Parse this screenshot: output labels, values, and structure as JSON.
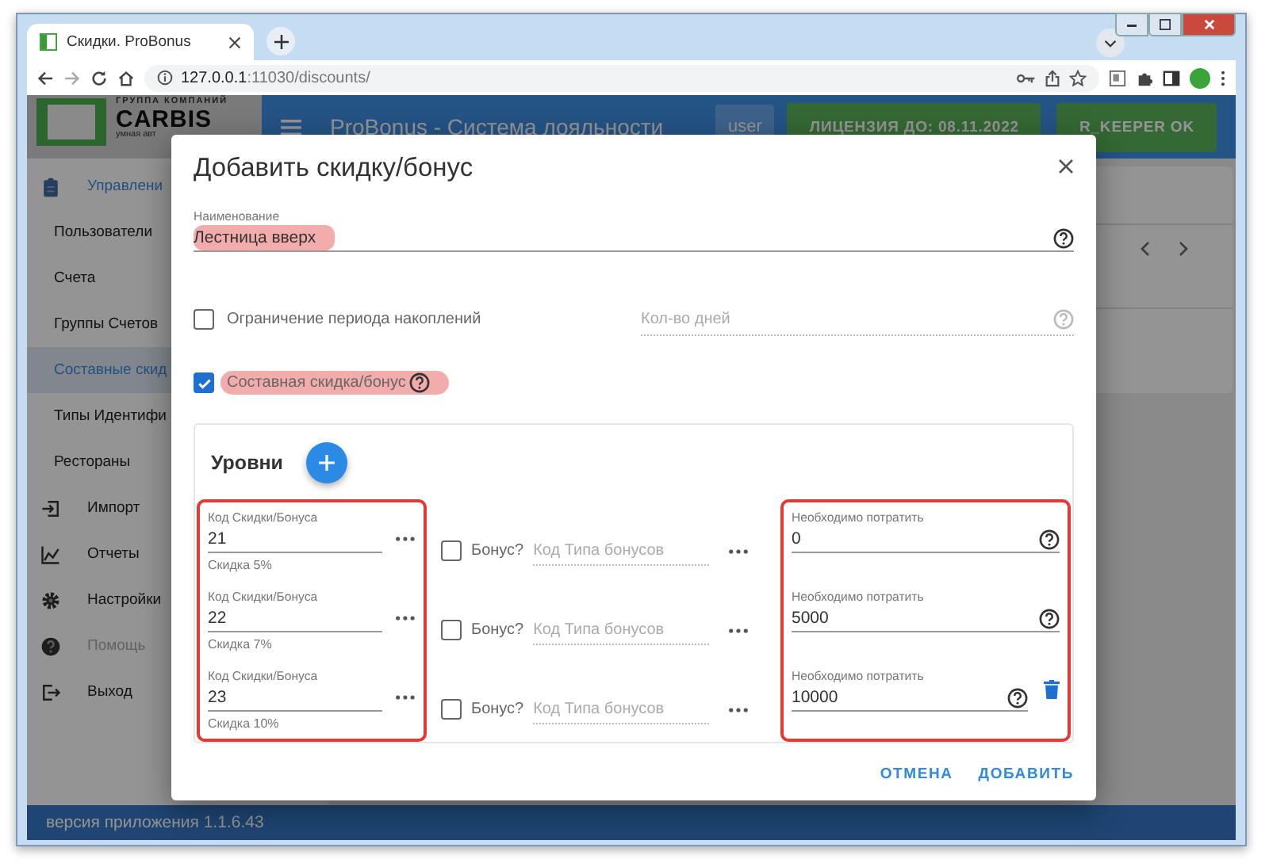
{
  "browser": {
    "tab_title": "Скидки. ProBonus",
    "url_host": "127.0.0.1",
    "url_path": ":11030/discounts/"
  },
  "app": {
    "logo": {
      "tagline": "ГРУППА КОМПАНИЙ",
      "name": "CARBIS",
      "slogan": "умная авт"
    },
    "title": "ProBonus - Система лояльности",
    "user": "user",
    "license": "ЛИЦЕНЗИЯ ДО: 08.11.2022",
    "status": "R_KEEPER OK"
  },
  "sidebar": {
    "items": [
      {
        "label": "Управлени",
        "kind": "section",
        "selected": false,
        "disabled": false
      },
      {
        "label": "Пользователи",
        "kind": "sub",
        "selected": false,
        "disabled": false
      },
      {
        "label": "Счета",
        "kind": "sub",
        "selected": false,
        "disabled": false
      },
      {
        "label": "Группы Счетов",
        "kind": "sub",
        "selected": false,
        "disabled": false
      },
      {
        "label": "Составные скид",
        "kind": "sub",
        "selected": true,
        "disabled": false
      },
      {
        "label": "Типы Идентифи",
        "kind": "sub",
        "selected": false,
        "disabled": false
      },
      {
        "label": "Рестораны",
        "kind": "sub",
        "selected": false,
        "disabled": false
      },
      {
        "label": "Импорт",
        "kind": "menu",
        "selected": false,
        "disabled": false
      },
      {
        "label": "Отчеты",
        "kind": "menu",
        "selected": false,
        "disabled": false
      },
      {
        "label": "Настройки",
        "kind": "menu",
        "selected": false,
        "disabled": false
      },
      {
        "label": "Помощь",
        "kind": "menu",
        "selected": false,
        "disabled": true
      },
      {
        "label": "Выход",
        "kind": "menu",
        "selected": false,
        "disabled": false
      }
    ]
  },
  "dialog": {
    "title": "Добавить скидку/бонус",
    "name": {
      "label": "Наименование",
      "value": "Лестница вверх",
      "highlighted": true
    },
    "period": {
      "label": "Ограничение периода накоплений",
      "checked": false
    },
    "days": {
      "placeholder": "Кол-во дней",
      "disabled": true
    },
    "composite": {
      "label": "Составная скидка/бонус",
      "checked": true,
      "highlighted": true
    },
    "levels": {
      "title": "Уровни",
      "code_framed": true,
      "spend_framed": true,
      "rows": [
        {
          "code_label": "Код Скидки/Бонуса",
          "code": "21",
          "code_hint": "Скидка 5%",
          "bonus_label": "Бонус?",
          "bonus_checked": false,
          "bonus_type_placeholder": "Код Типа бонусов",
          "spend_label": "Необходимо потратить",
          "spend": "0",
          "deletable": false
        },
        {
          "code_label": "Код Скидки/Бонуса",
          "code": "22",
          "code_hint": "Скидка 7%",
          "bonus_label": "Бонус?",
          "bonus_checked": false,
          "bonus_type_placeholder": "Код Типа бонусов",
          "spend_label": "Необходимо потратить",
          "spend": "5000",
          "deletable": false
        },
        {
          "code_label": "Код Скидки/Бонуса",
          "code": "23",
          "code_hint": "Скидка 10%",
          "bonus_label": "Бонус?",
          "bonus_checked": false,
          "bonus_type_placeholder": "Код Типа бонусов",
          "spend_label": "Необходимо потратить",
          "spend": "10000",
          "deletable": true
        }
      ]
    },
    "buttons": [
      {
        "label": "ОТМЕНА"
      },
      {
        "label": "ДОБАВИТЬ"
      }
    ]
  },
  "footer": {
    "version": "версия приложения 1.1.6.43"
  }
}
